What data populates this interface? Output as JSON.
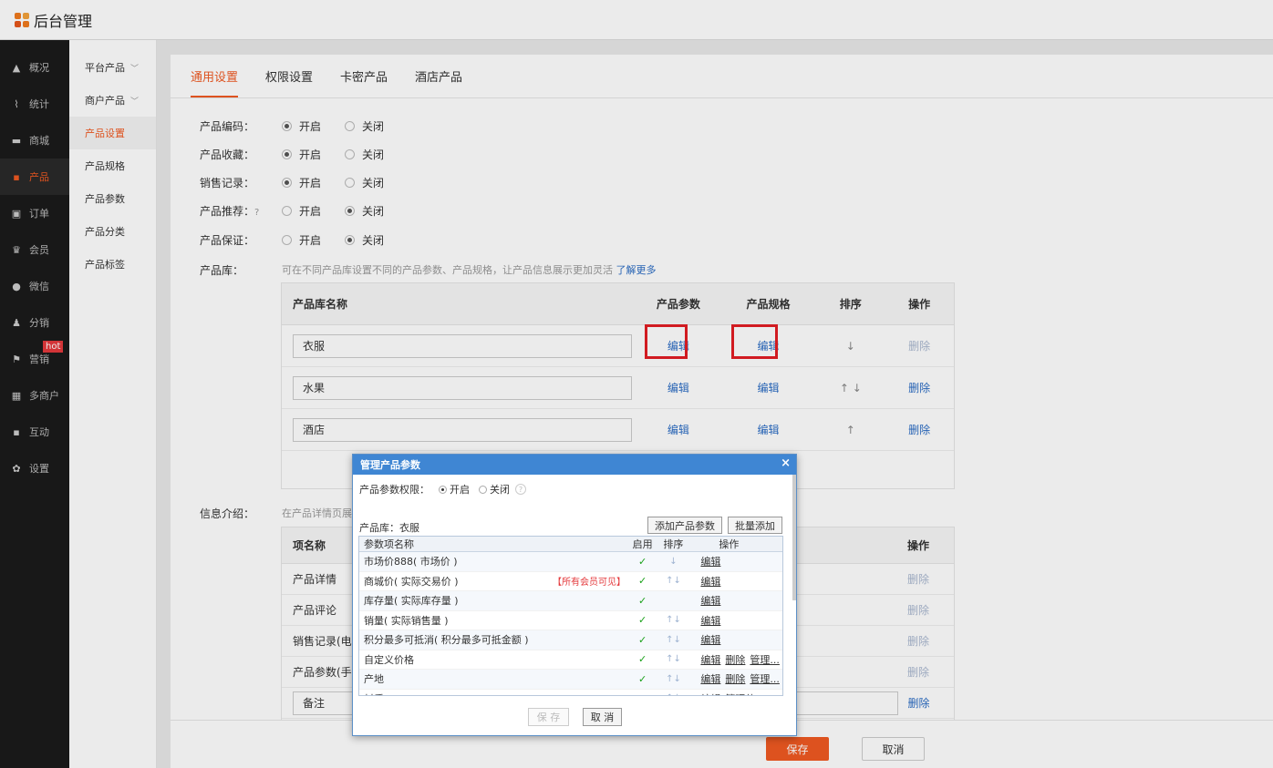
{
  "app": {
    "title": "后台管理"
  },
  "leftnav": {
    "items": [
      {
        "label": "概况",
        "icon": "graduation-cap-icon"
      },
      {
        "label": "统计",
        "icon": "chart-icon"
      },
      {
        "label": "商城",
        "icon": "store-icon"
      },
      {
        "label": "产品",
        "icon": "grid-icon"
      },
      {
        "label": "订单",
        "icon": "order-icon"
      },
      {
        "label": "会员",
        "icon": "crown-icon"
      },
      {
        "label": "微信",
        "icon": "wechat-icon"
      },
      {
        "label": "分销",
        "icon": "users-icon"
      },
      {
        "label": "营销",
        "icon": "flag-icon"
      },
      {
        "label": "多商户",
        "icon": "shop-icon"
      },
      {
        "label": "互动",
        "icon": "interaction-icon"
      },
      {
        "label": "设置",
        "icon": "gear-icon"
      }
    ],
    "hot_badge": "hot"
  },
  "subnav": {
    "items": [
      "平台产品",
      "商户产品",
      "产品设置",
      "产品规格",
      "产品参数",
      "产品分类",
      "产品标签"
    ]
  },
  "tabs": [
    "通用设置",
    "权限设置",
    "卡密产品",
    "酒店产品"
  ],
  "form": {
    "rows": [
      {
        "label": "产品编码：",
        "on": "开启",
        "off": "关闭"
      },
      {
        "label": "产品收藏：",
        "on": "开启",
        "off": "关闭"
      },
      {
        "label": "销售记录：",
        "on": "开启",
        "off": "关闭"
      },
      {
        "label": "产品推荐：",
        "on": "开启",
        "off": "关闭"
      },
      {
        "label": "产品保证：",
        "on": "开启",
        "off": "关闭"
      }
    ],
    "help_glyph": "?",
    "library_label": "产品库：",
    "library_hint": "可在不同产品库设置不同的产品参数、产品规格，让产品信息展示更加灵活",
    "library_link": "了解更多",
    "info_label": "信息介绍：",
    "info_hint": "在产品详情页展"
  },
  "library_table": {
    "headers": {
      "name": "产品库名称",
      "param": "产品参数",
      "spec": "产品规格",
      "sort": "排序",
      "op": "操作"
    },
    "rows": [
      {
        "name": "衣服",
        "param": "编辑",
        "spec": "编辑",
        "sort": "↓",
        "op": "删除"
      },
      {
        "name": "水果",
        "param": "编辑",
        "spec": "编辑",
        "sort": "↑ ↓",
        "op": "删除"
      },
      {
        "name": "酒店",
        "param": "编辑",
        "spec": "编辑",
        "sort": "↑",
        "op": "删除"
      }
    ]
  },
  "info_table": {
    "headers": {
      "name": "项名称",
      "op": "操作"
    },
    "rows": [
      "产品详情",
      "产品评论",
      "销售记录(电脑",
      "产品参数(手机"
    ],
    "remark": "备注",
    "op": "删除"
  },
  "footer": {
    "save": "保存",
    "cancel": "取消"
  },
  "dialog": {
    "title": "管理产品参数",
    "close": "×",
    "perm_label": "产品参数权限：",
    "perm_on": "开启",
    "perm_off": "关闭",
    "help": "?",
    "library": "产品库：衣服",
    "add_button": "添加产品参数",
    "batch_button": "批量添加",
    "headers": {
      "name": "参数项名称",
      "enabled": "启用",
      "sort": "排序",
      "op": "操作"
    },
    "rows": [
      {
        "name": "市场价888( 市场价 )",
        "note": "",
        "enabled": "✓",
        "sort": "↓",
        "ops": [
          "编辑"
        ]
      },
      {
        "name": "商城价( 实际交易价 )",
        "note": "【所有会员可见】",
        "enabled": "✓",
        "sort": "↑↓",
        "ops": [
          "编辑"
        ]
      },
      {
        "name": "库存量( 实际库存量 )",
        "note": "",
        "enabled": "✓",
        "sort": "",
        "ops": [
          "编辑"
        ]
      },
      {
        "name": "销量( 实际销售量 )",
        "note": "",
        "enabled": "✓",
        "sort": "↑↓",
        "ops": [
          "编辑"
        ]
      },
      {
        "name": "积分最多可抵消( 积分最多可抵金额 )",
        "note": "",
        "enabled": "✓",
        "sort": "↑↓",
        "ops": [
          "编辑"
        ]
      },
      {
        "name": "自定义价格",
        "note": "",
        "enabled": "✓",
        "sort": "↑↓",
        "ops": [
          "编辑",
          "删除",
          "管理..."
        ]
      },
      {
        "name": "产地",
        "note": "",
        "enabled": "✓",
        "sort": "↑↓",
        "ops": [
          "编辑",
          "删除",
          "管理..."
        ]
      },
      {
        "name": "材质",
        "note": "",
        "enabled": "✓",
        "sort": "↑↓",
        "ops": [
          "编辑",
          "管理值"
        ]
      }
    ],
    "save": "保 存",
    "cancel": "取 消"
  }
}
